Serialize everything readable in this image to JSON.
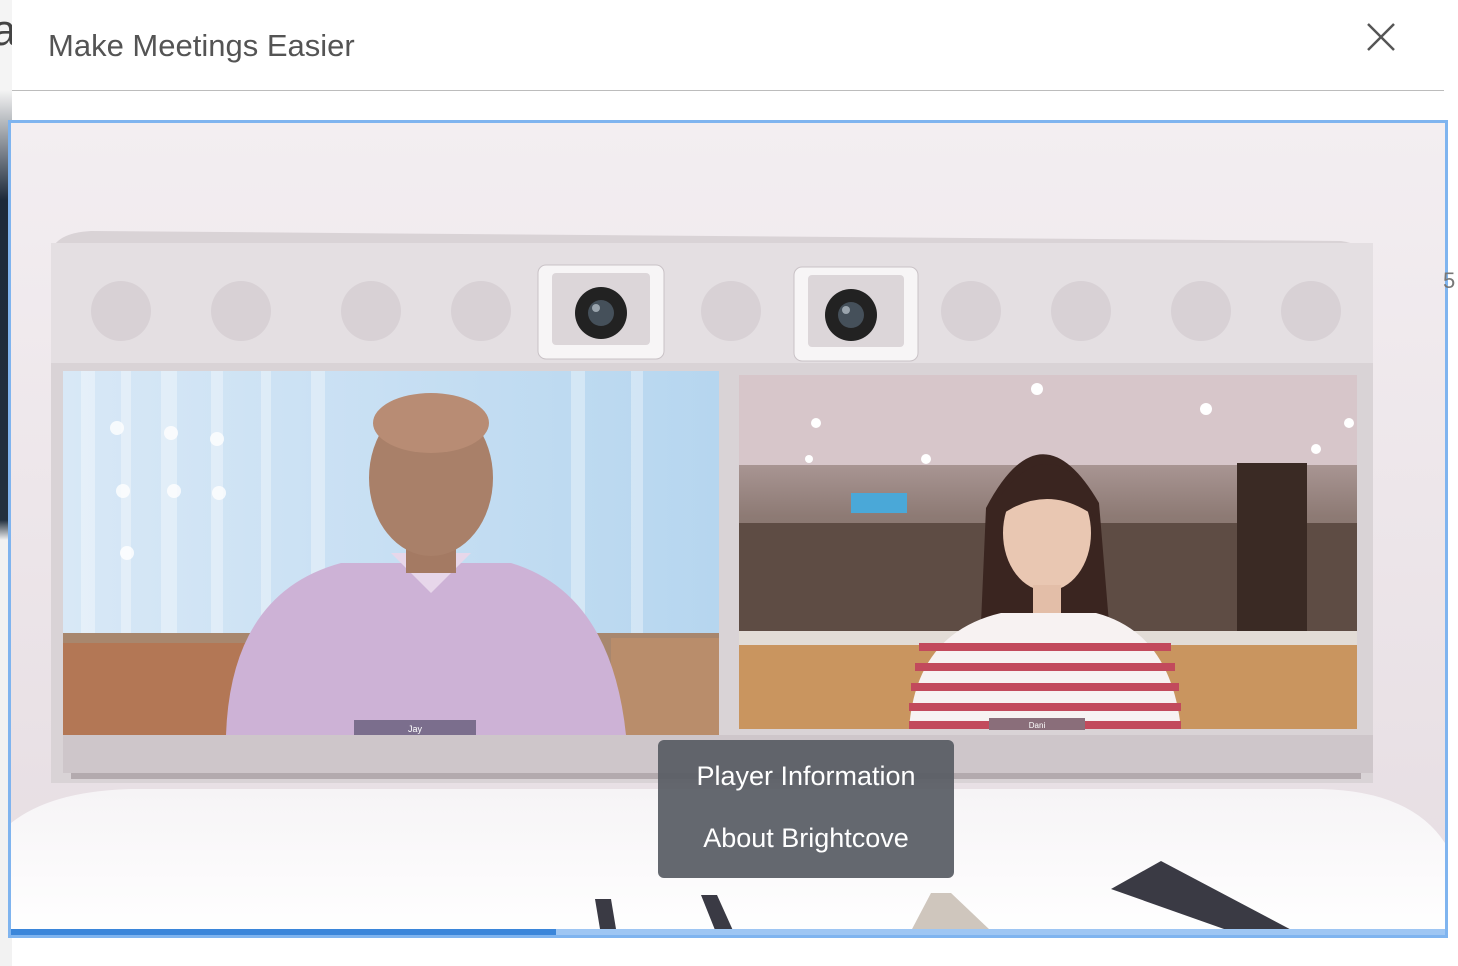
{
  "modal": {
    "title": "Make Meetings Easier"
  },
  "icons": {
    "close": "close-icon"
  },
  "video": {
    "left_name_tag": "Jay",
    "right_name_tag": "Dani",
    "progress_fraction": 0.38
  },
  "context_menu": {
    "items": [
      {
        "label": "Player Information"
      },
      {
        "label": "About Brightcove"
      }
    ]
  },
  "colors": {
    "player_border": "#7fb4ef",
    "progress_fill": "#3b86da",
    "menu_bg": "#585c64"
  }
}
